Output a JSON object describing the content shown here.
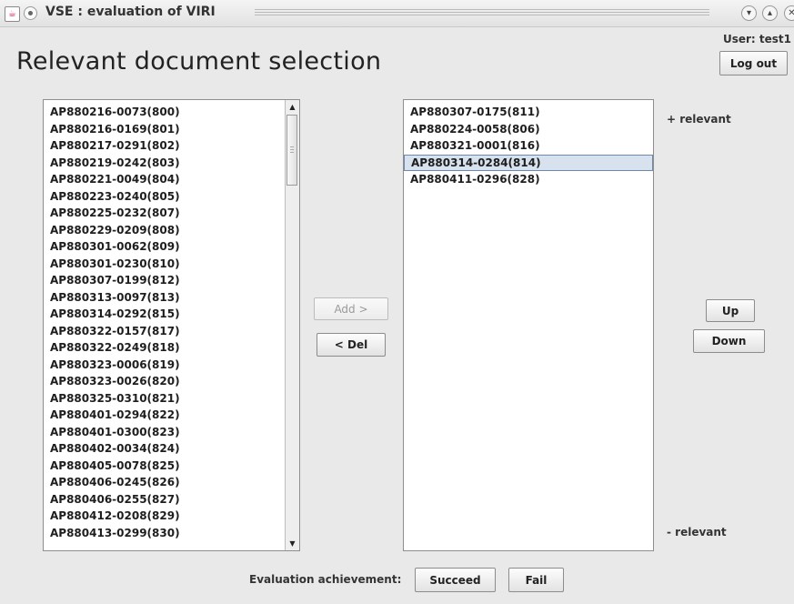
{
  "window": {
    "title": "VSE : evaluation of VIRI"
  },
  "header": {
    "page_title": "Relevant document selection",
    "user_label": "User: test1",
    "logout_label": "Log out"
  },
  "left_list": {
    "items": [
      "AP880216-0073(800)",
      "AP880216-0169(801)",
      "AP880217-0291(802)",
      "AP880219-0242(803)",
      "AP880221-0049(804)",
      "AP880223-0240(805)",
      "AP880225-0232(807)",
      "AP880229-0209(808)",
      "AP880301-0062(809)",
      "AP880301-0230(810)",
      "AP880307-0199(812)",
      "AP880313-0097(813)",
      "AP880314-0292(815)",
      "AP880322-0157(817)",
      "AP880322-0249(818)",
      "AP880323-0006(819)",
      "AP880323-0026(820)",
      "AP880325-0310(821)",
      "AP880401-0294(822)",
      "AP880401-0300(823)",
      "AP880402-0034(824)",
      "AP880405-0078(825)",
      "AP880406-0245(826)",
      "AP880406-0255(827)",
      "AP880412-0208(829)",
      "AP880413-0299(830)"
    ]
  },
  "actions": {
    "add_label": "Add >",
    "del_label": "< Del"
  },
  "right_list": {
    "items": [
      "AP880307-0175(811)",
      "AP880224-0058(806)",
      "AP880321-0001(816)",
      "AP880314-0284(814)",
      "AP880411-0296(828)"
    ],
    "selected_index": 3
  },
  "ordering": {
    "more_relevant": "+ relevant",
    "less_relevant": "- relevant",
    "up_label": "Up",
    "down_label": "Down"
  },
  "footer": {
    "evaluation_label": "Evaluation achievement:",
    "succeed_label": "Succeed",
    "fail_label": "Fail"
  },
  "colors": {
    "selection_bg": "#d7e2ee",
    "selection_border": "#6e8aa8",
    "window_bg": "#e9e9e9"
  }
}
